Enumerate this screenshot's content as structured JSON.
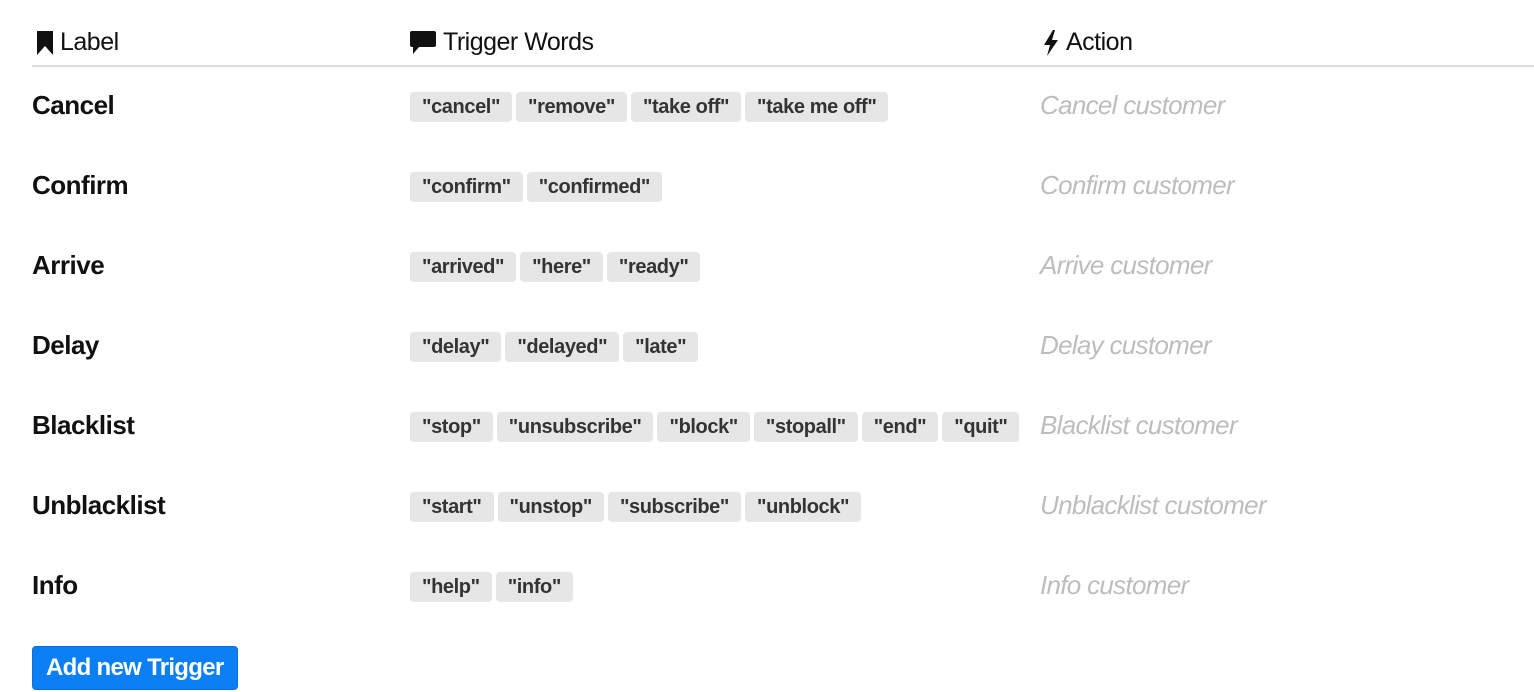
{
  "header": {
    "label": {
      "icon": "bookmark-icon",
      "text": "Label"
    },
    "trigger_words": {
      "icon": "comment-icon",
      "text": "Trigger Words"
    },
    "action": {
      "icon": "bolt-icon",
      "text": "Action"
    }
  },
  "triggers": [
    {
      "label": "Cancel",
      "words": [
        "\"cancel\"",
        "\"remove\"",
        "\"take off\"",
        "\"take me off\""
      ],
      "action": "Cancel customer"
    },
    {
      "label": "Confirm",
      "words": [
        "\"confirm\"",
        "\"confirmed\""
      ],
      "action": "Confirm customer"
    },
    {
      "label": "Arrive",
      "words": [
        "\"arrived\"",
        "\"here\"",
        "\"ready\""
      ],
      "action": "Arrive customer"
    },
    {
      "label": "Delay",
      "words": [
        "\"delay\"",
        "\"delayed\"",
        "\"late\""
      ],
      "action": "Delay customer"
    },
    {
      "label": "Blacklist",
      "words": [
        "\"stop\"",
        "\"unsubscribe\"",
        "\"block\"",
        "\"stopall\"",
        "\"end\"",
        "\"quit\""
      ],
      "action": "Blacklist customer"
    },
    {
      "label": "Unblacklist",
      "words": [
        "\"start\"",
        "\"unstop\"",
        "\"subscribe\"",
        "\"unblock\""
      ],
      "action": "Unblacklist customer"
    },
    {
      "label": "Info",
      "words": [
        "\"help\"",
        "\"info\""
      ],
      "action": "Info customer"
    }
  ],
  "add_button": {
    "label": "Add new Trigger"
  },
  "colors": {
    "accent": "#0d7ff4",
    "chip_bg": "#e6e6e6",
    "action_text": "#bdbdbd"
  }
}
